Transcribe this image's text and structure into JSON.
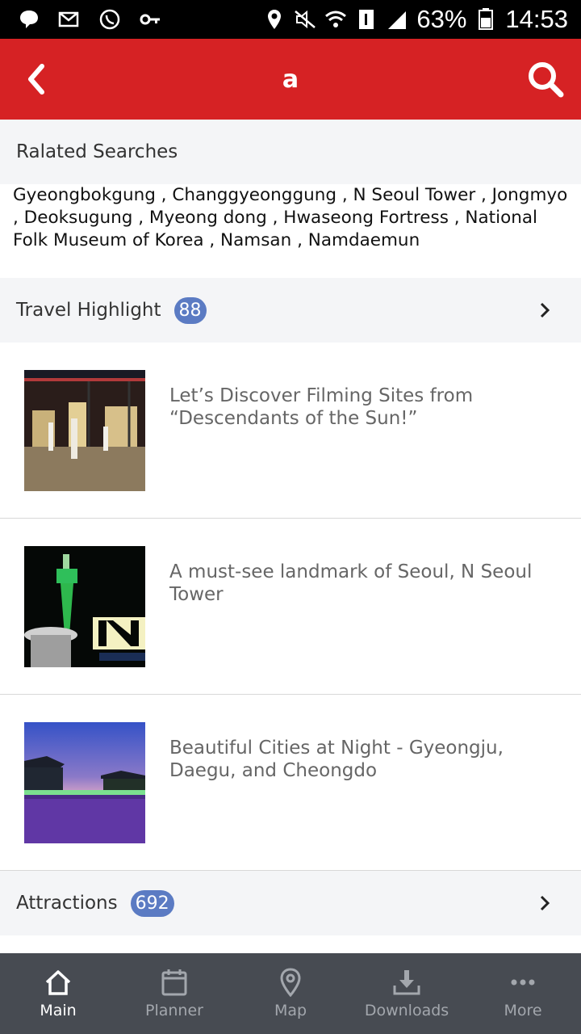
{
  "status_bar": {
    "battery": "63%",
    "time": "14:53",
    "icons": [
      "message-icon",
      "email-icon",
      "whatsapp-icon",
      "key-icon",
      "location-icon",
      "mute-icon",
      "wifi-icon",
      "sim-icon",
      "signal-icon",
      "battery-icon"
    ]
  },
  "header": {
    "title": "a",
    "back_icon": "chevron-left-icon",
    "search_icon": "search-icon",
    "accent_color": "#d62224"
  },
  "related": {
    "heading": "Ralated Searches",
    "text": "Gyeongbokgung , Changgyeonggung , N Seoul Tower , Jongmyo , Deoksugung , Myeong dong , Hwaseong Fortress , National Folk Museum of Korea , Namsan , Namdaemun"
  },
  "travel_highlight": {
    "label": "Travel Highlight",
    "count": "88",
    "items": [
      {
        "title": "Let’s Discover Filming Sites from “Descendants of the Sun!”"
      },
      {
        "title": "A must-see landmark of Seoul, N Seoul Tower"
      },
      {
        "title": "Beautiful Cities at Night - Gyeongju, Daegu, and Cheongdo"
      }
    ]
  },
  "attractions": {
    "label": "Attractions",
    "count": "692"
  },
  "nav": {
    "items": [
      {
        "label": "Main",
        "icon": "home-icon"
      },
      {
        "label": "Planner",
        "icon": "calendar-icon"
      },
      {
        "label": "Map",
        "icon": "map-pin-icon"
      },
      {
        "label": "Downloads",
        "icon": "download-icon"
      },
      {
        "label": "More",
        "icon": "more-icon"
      }
    ]
  }
}
